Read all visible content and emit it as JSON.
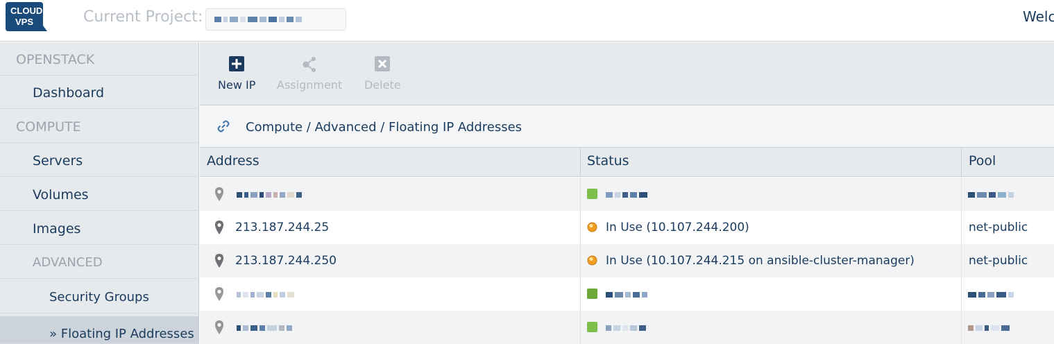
{
  "header": {
    "logo_line1": "CLOUD",
    "logo_line2": "VPS",
    "project_label": "Current Project:",
    "welcome_text": "Welc"
  },
  "sidebar": {
    "sections": [
      {
        "label": "OPENSTACK"
      },
      {
        "label": "Dashboard"
      },
      {
        "label": "COMPUTE"
      },
      {
        "label": "Servers"
      },
      {
        "label": "Volumes"
      },
      {
        "label": "Images"
      },
      {
        "label": "ADVANCED"
      },
      {
        "label": "Security Groups"
      },
      {
        "label": "» Floating IP Addresses"
      }
    ]
  },
  "toolbar": {
    "new_ip": "New IP",
    "assignment": "Assignment",
    "delete": "Delete"
  },
  "breadcrumb": {
    "text": "Compute / Advanced / Floating IP Addresses"
  },
  "table": {
    "columns": [
      "Address",
      "Status",
      "Pool"
    ],
    "rows": [
      {
        "address": "",
        "status": "",
        "pool": "",
        "status_color": "#7cc04b"
      },
      {
        "address": "213.187.244.25",
        "status": "In Use (10.107.244.200)",
        "pool": "net-public",
        "status_color": "#f0a020"
      },
      {
        "address": "213.187.244.250",
        "status": "In Use (10.107.244.215 on ansible-cluster-manager)",
        "pool": "net-public",
        "status_color": "#f0a020"
      },
      {
        "address": "",
        "status": "",
        "pool": "",
        "status_color": "#7cc04b"
      },
      {
        "address": "",
        "status": "",
        "pool": "",
        "status_color": "#7cc04b"
      }
    ]
  },
  "colors": {
    "brand": "#1a4a7a",
    "text": "#1a3b5d",
    "muted": "#9aa4ae",
    "panel": "#e7eaed"
  }
}
